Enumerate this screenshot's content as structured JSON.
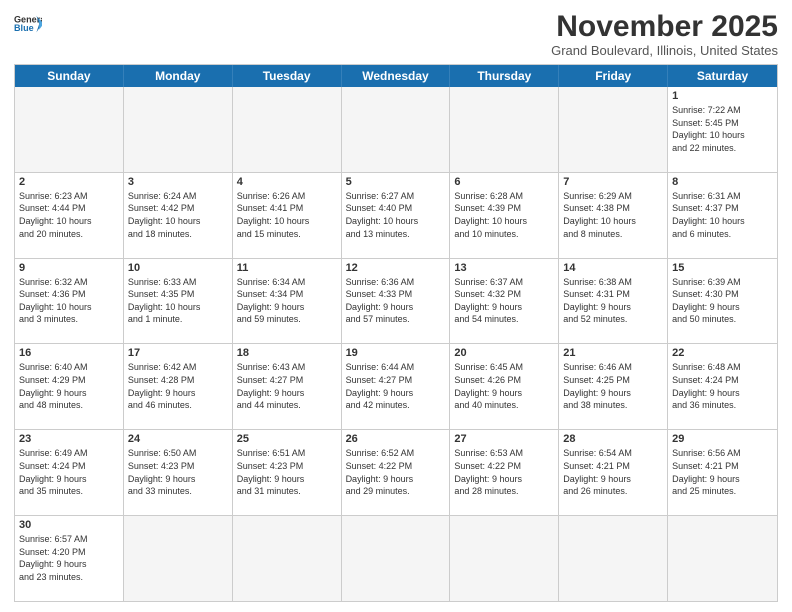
{
  "header": {
    "logo_general": "General",
    "logo_blue": "Blue",
    "month": "November 2025",
    "location": "Grand Boulevard, Illinois, United States"
  },
  "day_headers": [
    "Sunday",
    "Monday",
    "Tuesday",
    "Wednesday",
    "Thursday",
    "Friday",
    "Saturday"
  ],
  "weeks": [
    [
      {
        "num": "",
        "info": "",
        "empty": true
      },
      {
        "num": "",
        "info": "",
        "empty": true
      },
      {
        "num": "",
        "info": "",
        "empty": true
      },
      {
        "num": "",
        "info": "",
        "empty": true
      },
      {
        "num": "",
        "info": "",
        "empty": true
      },
      {
        "num": "",
        "info": "",
        "empty": true
      },
      {
        "num": "1",
        "info": "Sunrise: 7:22 AM\nSunset: 5:45 PM\nDaylight: 10 hours\nand 22 minutes.",
        "empty": false
      }
    ],
    [
      {
        "num": "2",
        "info": "Sunrise: 6:23 AM\nSunset: 4:44 PM\nDaylight: 10 hours\nand 20 minutes.",
        "empty": false
      },
      {
        "num": "3",
        "info": "Sunrise: 6:24 AM\nSunset: 4:42 PM\nDaylight: 10 hours\nand 18 minutes.",
        "empty": false
      },
      {
        "num": "4",
        "info": "Sunrise: 6:26 AM\nSunset: 4:41 PM\nDaylight: 10 hours\nand 15 minutes.",
        "empty": false
      },
      {
        "num": "5",
        "info": "Sunrise: 6:27 AM\nSunset: 4:40 PM\nDaylight: 10 hours\nand 13 minutes.",
        "empty": false
      },
      {
        "num": "6",
        "info": "Sunrise: 6:28 AM\nSunset: 4:39 PM\nDaylight: 10 hours\nand 10 minutes.",
        "empty": false
      },
      {
        "num": "7",
        "info": "Sunrise: 6:29 AM\nSunset: 4:38 PM\nDaylight: 10 hours\nand 8 minutes.",
        "empty": false
      },
      {
        "num": "8",
        "info": "Sunrise: 6:31 AM\nSunset: 4:37 PM\nDaylight: 10 hours\nand 6 minutes.",
        "empty": false
      }
    ],
    [
      {
        "num": "9",
        "info": "Sunrise: 6:32 AM\nSunset: 4:36 PM\nDaylight: 10 hours\nand 3 minutes.",
        "empty": false
      },
      {
        "num": "10",
        "info": "Sunrise: 6:33 AM\nSunset: 4:35 PM\nDaylight: 10 hours\nand 1 minute.",
        "empty": false
      },
      {
        "num": "11",
        "info": "Sunrise: 6:34 AM\nSunset: 4:34 PM\nDaylight: 9 hours\nand 59 minutes.",
        "empty": false
      },
      {
        "num": "12",
        "info": "Sunrise: 6:36 AM\nSunset: 4:33 PM\nDaylight: 9 hours\nand 57 minutes.",
        "empty": false
      },
      {
        "num": "13",
        "info": "Sunrise: 6:37 AM\nSunset: 4:32 PM\nDaylight: 9 hours\nand 54 minutes.",
        "empty": false
      },
      {
        "num": "14",
        "info": "Sunrise: 6:38 AM\nSunset: 4:31 PM\nDaylight: 9 hours\nand 52 minutes.",
        "empty": false
      },
      {
        "num": "15",
        "info": "Sunrise: 6:39 AM\nSunset: 4:30 PM\nDaylight: 9 hours\nand 50 minutes.",
        "empty": false
      }
    ],
    [
      {
        "num": "16",
        "info": "Sunrise: 6:40 AM\nSunset: 4:29 PM\nDaylight: 9 hours\nand 48 minutes.",
        "empty": false
      },
      {
        "num": "17",
        "info": "Sunrise: 6:42 AM\nSunset: 4:28 PM\nDaylight: 9 hours\nand 46 minutes.",
        "empty": false
      },
      {
        "num": "18",
        "info": "Sunrise: 6:43 AM\nSunset: 4:27 PM\nDaylight: 9 hours\nand 44 minutes.",
        "empty": false
      },
      {
        "num": "19",
        "info": "Sunrise: 6:44 AM\nSunset: 4:27 PM\nDaylight: 9 hours\nand 42 minutes.",
        "empty": false
      },
      {
        "num": "20",
        "info": "Sunrise: 6:45 AM\nSunset: 4:26 PM\nDaylight: 9 hours\nand 40 minutes.",
        "empty": false
      },
      {
        "num": "21",
        "info": "Sunrise: 6:46 AM\nSunset: 4:25 PM\nDaylight: 9 hours\nand 38 minutes.",
        "empty": false
      },
      {
        "num": "22",
        "info": "Sunrise: 6:48 AM\nSunset: 4:24 PM\nDaylight: 9 hours\nand 36 minutes.",
        "empty": false
      }
    ],
    [
      {
        "num": "23",
        "info": "Sunrise: 6:49 AM\nSunset: 4:24 PM\nDaylight: 9 hours\nand 35 minutes.",
        "empty": false
      },
      {
        "num": "24",
        "info": "Sunrise: 6:50 AM\nSunset: 4:23 PM\nDaylight: 9 hours\nand 33 minutes.",
        "empty": false
      },
      {
        "num": "25",
        "info": "Sunrise: 6:51 AM\nSunset: 4:23 PM\nDaylight: 9 hours\nand 31 minutes.",
        "empty": false
      },
      {
        "num": "26",
        "info": "Sunrise: 6:52 AM\nSunset: 4:22 PM\nDaylight: 9 hours\nand 29 minutes.",
        "empty": false
      },
      {
        "num": "27",
        "info": "Sunrise: 6:53 AM\nSunset: 4:22 PM\nDaylight: 9 hours\nand 28 minutes.",
        "empty": false
      },
      {
        "num": "28",
        "info": "Sunrise: 6:54 AM\nSunset: 4:21 PM\nDaylight: 9 hours\nand 26 minutes.",
        "empty": false
      },
      {
        "num": "29",
        "info": "Sunrise: 6:56 AM\nSunset: 4:21 PM\nDaylight: 9 hours\nand 25 minutes.",
        "empty": false
      }
    ],
    [
      {
        "num": "30",
        "info": "Sunrise: 6:57 AM\nSunset: 4:20 PM\nDaylight: 9 hours\nand 23 minutes.",
        "empty": false
      },
      {
        "num": "",
        "info": "",
        "empty": true
      },
      {
        "num": "",
        "info": "",
        "empty": true
      },
      {
        "num": "",
        "info": "",
        "empty": true
      },
      {
        "num": "",
        "info": "",
        "empty": true
      },
      {
        "num": "",
        "info": "",
        "empty": true
      },
      {
        "num": "",
        "info": "",
        "empty": true
      }
    ]
  ]
}
